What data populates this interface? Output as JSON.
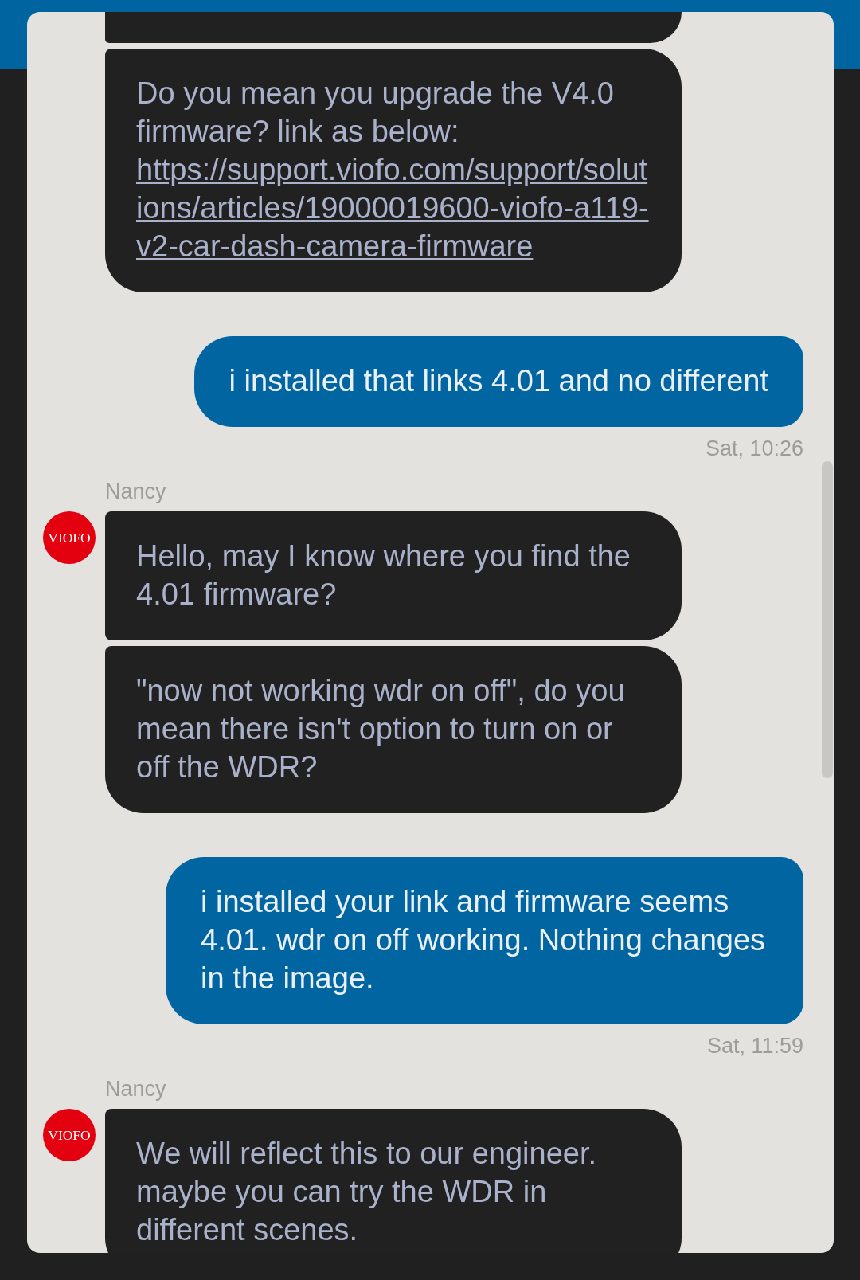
{
  "thread": [
    {
      "kind": "incoming",
      "messages": [
        {
          "kind": "clipped"
        },
        {
          "kind": "link_text",
          "text": "Do you mean you upgrade the V4.0 firmware? link as below:",
          "link": "https://support.viofo.com/support/solutions/articles/19000019600-viofo-a119-v2-car-dash-camera-firmware"
        }
      ]
    },
    {
      "kind": "outgoing",
      "messages": [
        {
          "kind": "text",
          "text": "i installed that links 4.01 and no different"
        }
      ],
      "time": "Sat, 10:26"
    },
    {
      "kind": "incoming",
      "sender": "Nancy",
      "avatar": "VIOFO",
      "messages": [
        {
          "kind": "text",
          "text": "Hello, may I know where you find the 4.01 firmware?"
        },
        {
          "kind": "text",
          "text": "\"now not working wdr on off\", do you mean there isn't option to turn on or off the WDR?"
        }
      ]
    },
    {
      "kind": "outgoing",
      "messages": [
        {
          "kind": "text",
          "text": "i installed your link and firmware seems 4.01. wdr on off working. Nothing changes in the image."
        }
      ],
      "time": "Sat, 11:59"
    },
    {
      "kind": "incoming",
      "sender": "Nancy",
      "avatar": "VIOFO",
      "messages": [
        {
          "kind": "text",
          "text": "We will reflect this to our engineer. maybe you can try the WDR in different scenes."
        }
      ]
    }
  ]
}
